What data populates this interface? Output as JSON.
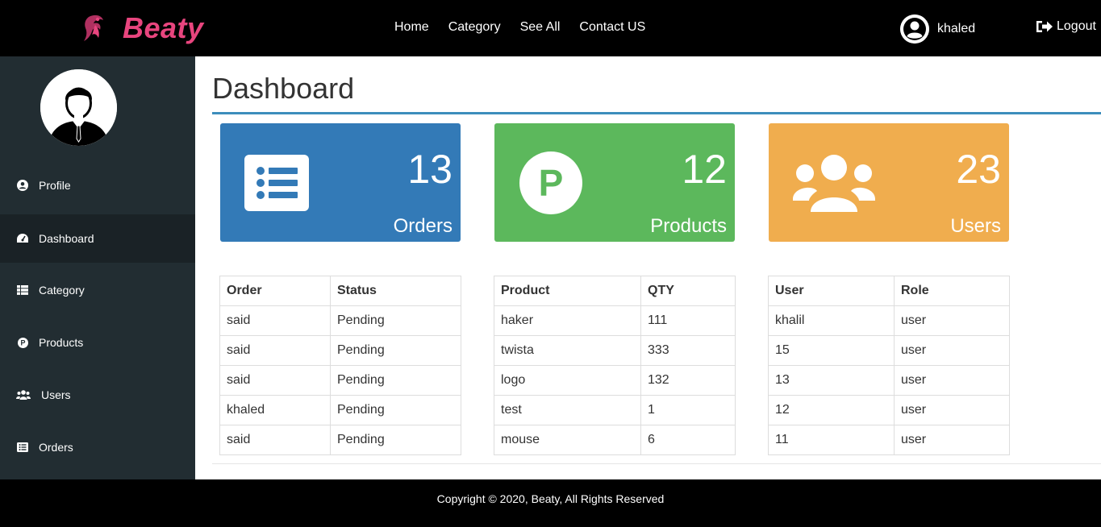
{
  "colors": {
    "accent": "#e8457e",
    "orders_card": "#337ab7",
    "products_card": "#5cb85c",
    "users_card": "#f0ad4e",
    "sidebar_bg": "#222d32",
    "rule": "#3c8dbc"
  },
  "brand": {
    "name": "Beaty",
    "icon": "brand-logo-icon"
  },
  "nav": [
    {
      "label": "Home"
    },
    {
      "label": "Category"
    },
    {
      "label": "See All"
    },
    {
      "label": "Contact US"
    }
  ],
  "user": {
    "name": "khaled",
    "icon": "user-circle-icon"
  },
  "logout": {
    "label": "Logout",
    "icon": "sign-out-icon"
  },
  "sidebar": {
    "avatar": "avatar-icon",
    "items": [
      {
        "label": "Profile",
        "icon": "user-circle-icon",
        "active": false
      },
      {
        "label": "Dashboard",
        "icon": "tachometer-icon",
        "active": true
      },
      {
        "label": "Category",
        "icon": "th-list-icon",
        "active": false
      },
      {
        "label": "Products",
        "icon": "product-p-icon",
        "active": false
      },
      {
        "label": "Users",
        "icon": "users-icon",
        "active": false
      },
      {
        "label": "Orders",
        "icon": "list-alt-icon",
        "active": false
      }
    ]
  },
  "page": {
    "title": "Dashboard"
  },
  "cards": [
    {
      "count": "13",
      "label": "Orders",
      "icon": "list-alt-icon"
    },
    {
      "count": "12",
      "label": "Products",
      "icon": "product-p-icon"
    },
    {
      "count": "23",
      "label": "Users",
      "icon": "users-icon"
    }
  ],
  "orders_table": {
    "headers": [
      "Order",
      "Status"
    ],
    "rows": [
      [
        "said",
        "Pending"
      ],
      [
        "said",
        "Pending"
      ],
      [
        "said",
        "Pending"
      ],
      [
        "khaled",
        "Pending"
      ],
      [
        "said",
        "Pending"
      ]
    ]
  },
  "products_table": {
    "headers": [
      "Product",
      "QTY"
    ],
    "rows": [
      [
        "haker",
        "111"
      ],
      [
        "twista",
        "333"
      ],
      [
        "logo",
        "132"
      ],
      [
        "test",
        "1"
      ],
      [
        "mouse",
        "6"
      ]
    ]
  },
  "users_table": {
    "headers": [
      "User",
      "Role"
    ],
    "rows": [
      [
        "khalil",
        "user"
      ],
      [
        "15",
        "user"
      ],
      [
        "13",
        "user"
      ],
      [
        "12",
        "user"
      ],
      [
        "11",
        "user"
      ]
    ]
  },
  "footer": {
    "text": "Copyright © 2020, Beaty, All Rights Reserved"
  }
}
